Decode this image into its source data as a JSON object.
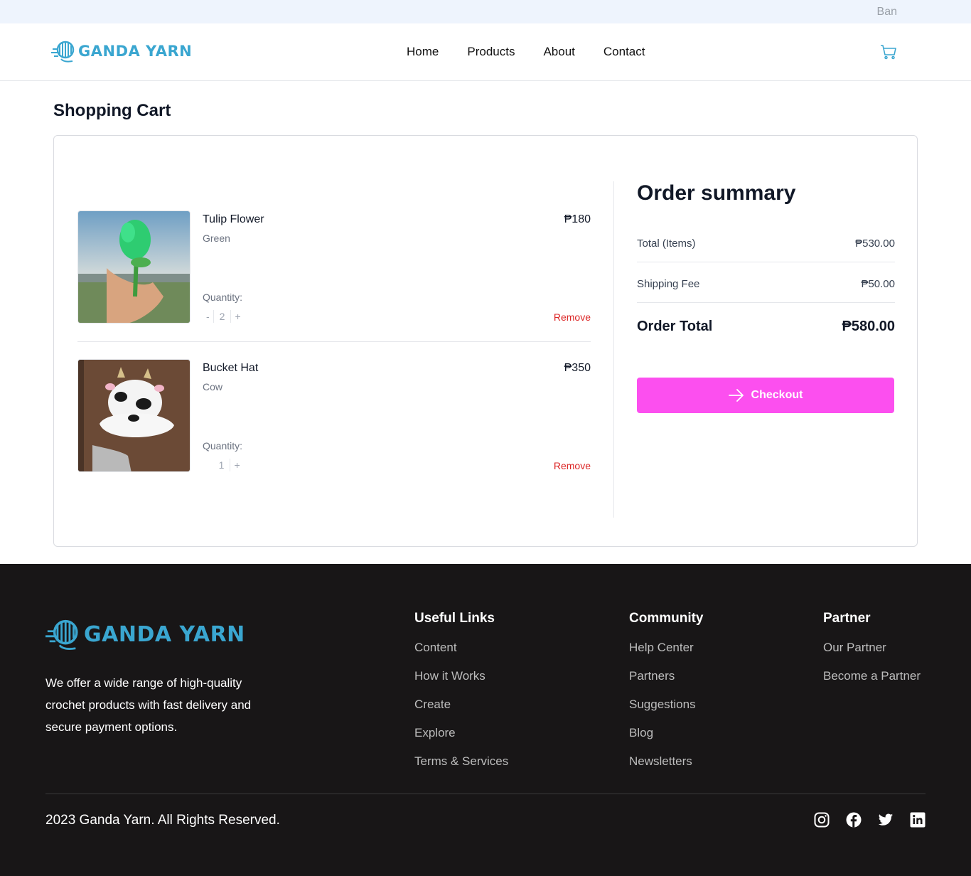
{
  "topbar": {
    "user_name": "Ban"
  },
  "brand": {
    "name": "GANDA YARN",
    "color": "#3aa6d0"
  },
  "nav": {
    "links": [
      "Home",
      "Products",
      "About",
      "Contact"
    ],
    "cart_icon": "shopping-cart-icon"
  },
  "page": {
    "title": "Shopping Cart"
  },
  "cart": {
    "items": [
      {
        "name": "Tulip Flower",
        "variant": "Green",
        "price": "₱180",
        "quantity_label": "Quantity:",
        "quantity": "2",
        "minus": "-",
        "plus": "+",
        "remove_label": "Remove"
      },
      {
        "name": "Bucket Hat",
        "variant": "Cow",
        "price": "₱350",
        "quantity_label": "Quantity:",
        "quantity": "1",
        "minus": "-",
        "plus": "+",
        "remove_label": "Remove"
      }
    ]
  },
  "summary": {
    "title": "Order summary",
    "total_items_label": "Total (Items)",
    "total_items_value": "₱530.00",
    "shipping_label": "Shipping Fee",
    "shipping_value": "₱50.00",
    "order_total_label": "Order Total",
    "order_total_value": "₱580.00",
    "checkout_label": "Checkout",
    "checkout_color": "#fc4fef"
  },
  "footer": {
    "description": "We offer a wide range of high-quality crochet products with fast delivery and secure payment options.",
    "columns": [
      {
        "title": "Useful Links",
        "links": [
          "Content",
          "How it Works",
          "Create",
          "Explore",
          "Terms & Services"
        ]
      },
      {
        "title": "Community",
        "links": [
          "Help Center",
          "Partners",
          "Suggestions",
          "Blog",
          "Newsletters"
        ]
      },
      {
        "title": "Partner",
        "links": [
          "Our Partner",
          "Become a Partner"
        ]
      }
    ],
    "copyright": "2023 Ganda Yarn. All Rights Reserved.",
    "socials": [
      "instagram-icon",
      "facebook-icon",
      "twitter-icon",
      "linkedin-icon"
    ]
  }
}
